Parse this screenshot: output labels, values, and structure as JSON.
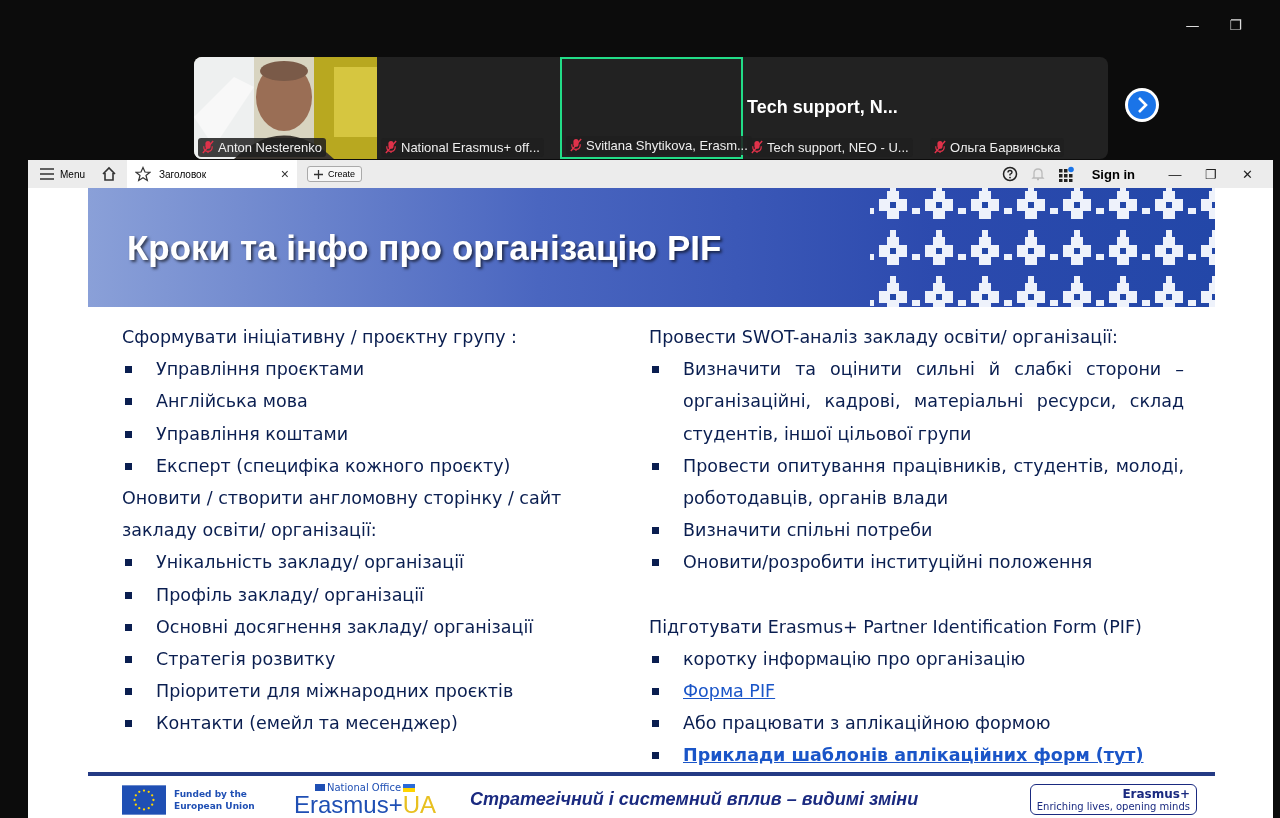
{
  "window_controls": [
    "—",
    "❐"
  ],
  "participants": [
    {
      "name": "Anton Nesterenko",
      "kind": "picture",
      "muted": true,
      "selected": false
    },
    {
      "name": "National Erasmus+ off...",
      "kind": "blank",
      "muted": true,
      "selected": false
    },
    {
      "name": "Svitlana Shytikova, Erasm...",
      "kind": "blank",
      "muted": true,
      "selected": true
    },
    {
      "name": "Tech support, NEO - U...",
      "kind": "title",
      "title": "Tech support, N...",
      "muted": true,
      "selected": false
    },
    {
      "name": "Ольга Барвинська",
      "kind": "blank",
      "muted": true,
      "selected": false
    }
  ],
  "browser": {
    "menu": "Menu",
    "tab": "Заголовок",
    "tab_close": "×",
    "create": "Create",
    "sign_in": "Sign in",
    "controls": [
      "—",
      "❐",
      "✕"
    ]
  },
  "slide": {
    "title": "Кроки та інфо про організацію PIF",
    "columns": [
      [
        {
          "kind": "heading",
          "text": "Сформувати ініціативну / проєктну групу :"
        },
        {
          "kind": "bullet",
          "text": "Управління проєктами"
        },
        {
          "kind": "bullet",
          "text": "Англійська мова"
        },
        {
          "kind": "bullet",
          "text": "Управління коштами"
        },
        {
          "kind": "bullet",
          "text": "Експерт (специфіка кожного проєкту)"
        },
        {
          "kind": "heading",
          "text": "Оновити / створити англомовну сторінку / сайт закладу освіти/ організації:"
        },
        {
          "kind": "bullet",
          "text": "Унікальність закладу/ організації"
        },
        {
          "kind": "bullet",
          "text": "Профіль закладу/ організації"
        },
        {
          "kind": "bullet",
          "text": "Основні досягнення закладу/ організації"
        },
        {
          "kind": "bullet",
          "text": "Стратегія розвитку"
        },
        {
          "kind": "bullet",
          "text": "Пріоритети для міжнародних проєктів"
        },
        {
          "kind": "bullet",
          "text": "Контакти (емейл та месенджер)"
        }
      ],
      [
        {
          "kind": "heading",
          "text": "Провести SWOT-аналіз закладу освіти/ організації:"
        },
        {
          "kind": "bullet",
          "text": "Визначити та оцінити сильні й слабкі сторони – організаційні, кадрові, матеріальні ресурси, склад студентів, іншої цільової групи"
        },
        {
          "kind": "bullet",
          "text": "Провести опитування працівників, студентів, молоді, роботодавців, органів влади"
        },
        {
          "kind": "bullet",
          "text": "Визначити спільні потреби"
        },
        {
          "kind": "bullet",
          "text": "Оновити/розробити інституційні положення"
        },
        {
          "kind": "gap"
        },
        {
          "kind": "heading",
          "text": "Підготувати Erasmus+ Partner Identification Form (PIF)"
        },
        {
          "kind": "bullet",
          "text": "коротку інформацію про організацію"
        },
        {
          "kind": "link",
          "text": "Форма PIF"
        },
        {
          "kind": "bullet",
          "text": "Або працювати з аплікаційною формою"
        },
        {
          "kind": "link_bold",
          "text": "Приклади шаблонів аплікаційних форм (тут)"
        }
      ]
    ]
  },
  "footer": {
    "funded": "Funded by the European Union",
    "office": "National Office",
    "brand": "Erasmus+",
    "brand_suffix": "UA",
    "slogan": "Стратегічний і системний вплив – видимі зміни",
    "badge_title": "Erasmus+",
    "badge_sub": "Enriching lives, opening minds"
  }
}
